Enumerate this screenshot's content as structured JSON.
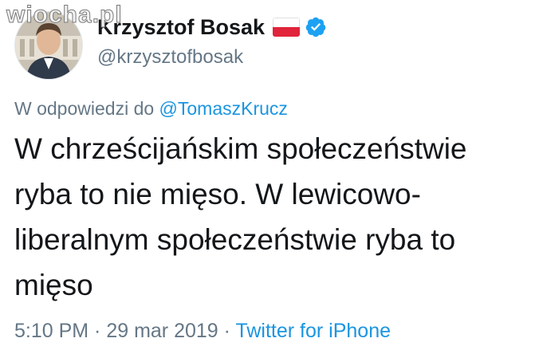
{
  "watermark": "wiocha.pl",
  "user": {
    "display_name": "Krzysztof Bosak",
    "handle": "@krzysztofbosak",
    "flag_icon": "poland-flag-icon",
    "verified_icon": "verified-badge-icon"
  },
  "reply": {
    "prefix": "W odpowiedzi do ",
    "mention": "@TomaszKrucz"
  },
  "tweet": {
    "text": "W chrześcijańskim społeczeństwie\nryba to nie mięso. W lewicowo-\nliberalnym społeczeństwie ryba to\nmięso"
  },
  "meta": {
    "time": "5:10 PM",
    "sep1": " · ",
    "date": "29 mar 2019",
    "sep2": " · ",
    "source": "Twitter for iPhone"
  },
  "colors": {
    "link": "#1b95e0",
    "secondary": "#657786",
    "primary": "#14171a"
  }
}
